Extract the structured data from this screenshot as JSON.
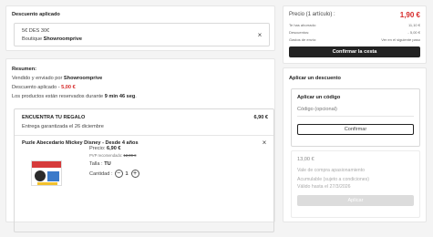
{
  "discount_card": {
    "title": "Descuento aplicado",
    "coupon_code": "5€ DES 30€",
    "shop_prefix": "Boutique",
    "shop_name": "Showroomprive"
  },
  "summary": {
    "title": "Resumen:",
    "sold_by_prefix": "Vendido y enviado por",
    "sold_by": "Showroomprive",
    "discount_prefix": "Descuento aplicado -",
    "discount_value": "5,00 €",
    "reserved_prefix": "Los productos están reservados durante",
    "reserved_time": "9 min 46 seg",
    "reserved_suffix": "."
  },
  "gift": {
    "title": "ENCUENTRA TU REGALO",
    "price": "6,90 €",
    "delivery": "Entrega garantizada el 26 diciembre"
  },
  "product": {
    "name": "Puzle Abecedario Mickey Disney - Desde 4 años",
    "price_label": "Precio:",
    "price": "6,90 €",
    "recommended_label": "PVP recomendado:",
    "recommended_price": "12,99 €",
    "size_label": "Talla :",
    "size": "TU",
    "quantity_label": "Cantidad :",
    "quantity": "1",
    "minus": "−",
    "plus": "+",
    "remove_icon": "×"
  },
  "totals": {
    "label": "Precio (1 artículo) :",
    "amount": "1,90 €",
    "rows": [
      {
        "label": "Te has ahorrado:",
        "value": "11,10 €"
      },
      {
        "label": "Descuentos:",
        "value": "- 5,00 €"
      },
      {
        "label": "Gastos de envío:",
        "value": "Ver en el siguiente paso"
      }
    ],
    "confirm_button": "Confirmar la cesta"
  },
  "apply_discount": {
    "title": "Aplicar un descuento",
    "code_title": "Aplicar un código",
    "code_placeholder": "Código (opcional)",
    "confirm_button": "Confirmar",
    "balance_amount": "13,00 €",
    "balance_line1": "Vale de compra apasionamiento",
    "balance_line2": "Acumulable (sujeto a condiciones)",
    "balance_line3": "Válido hasta el 27/3/2026",
    "apply_button": "Aplicar"
  },
  "colors": {
    "accent_red": "#d62828",
    "dark_button": "#222222"
  }
}
